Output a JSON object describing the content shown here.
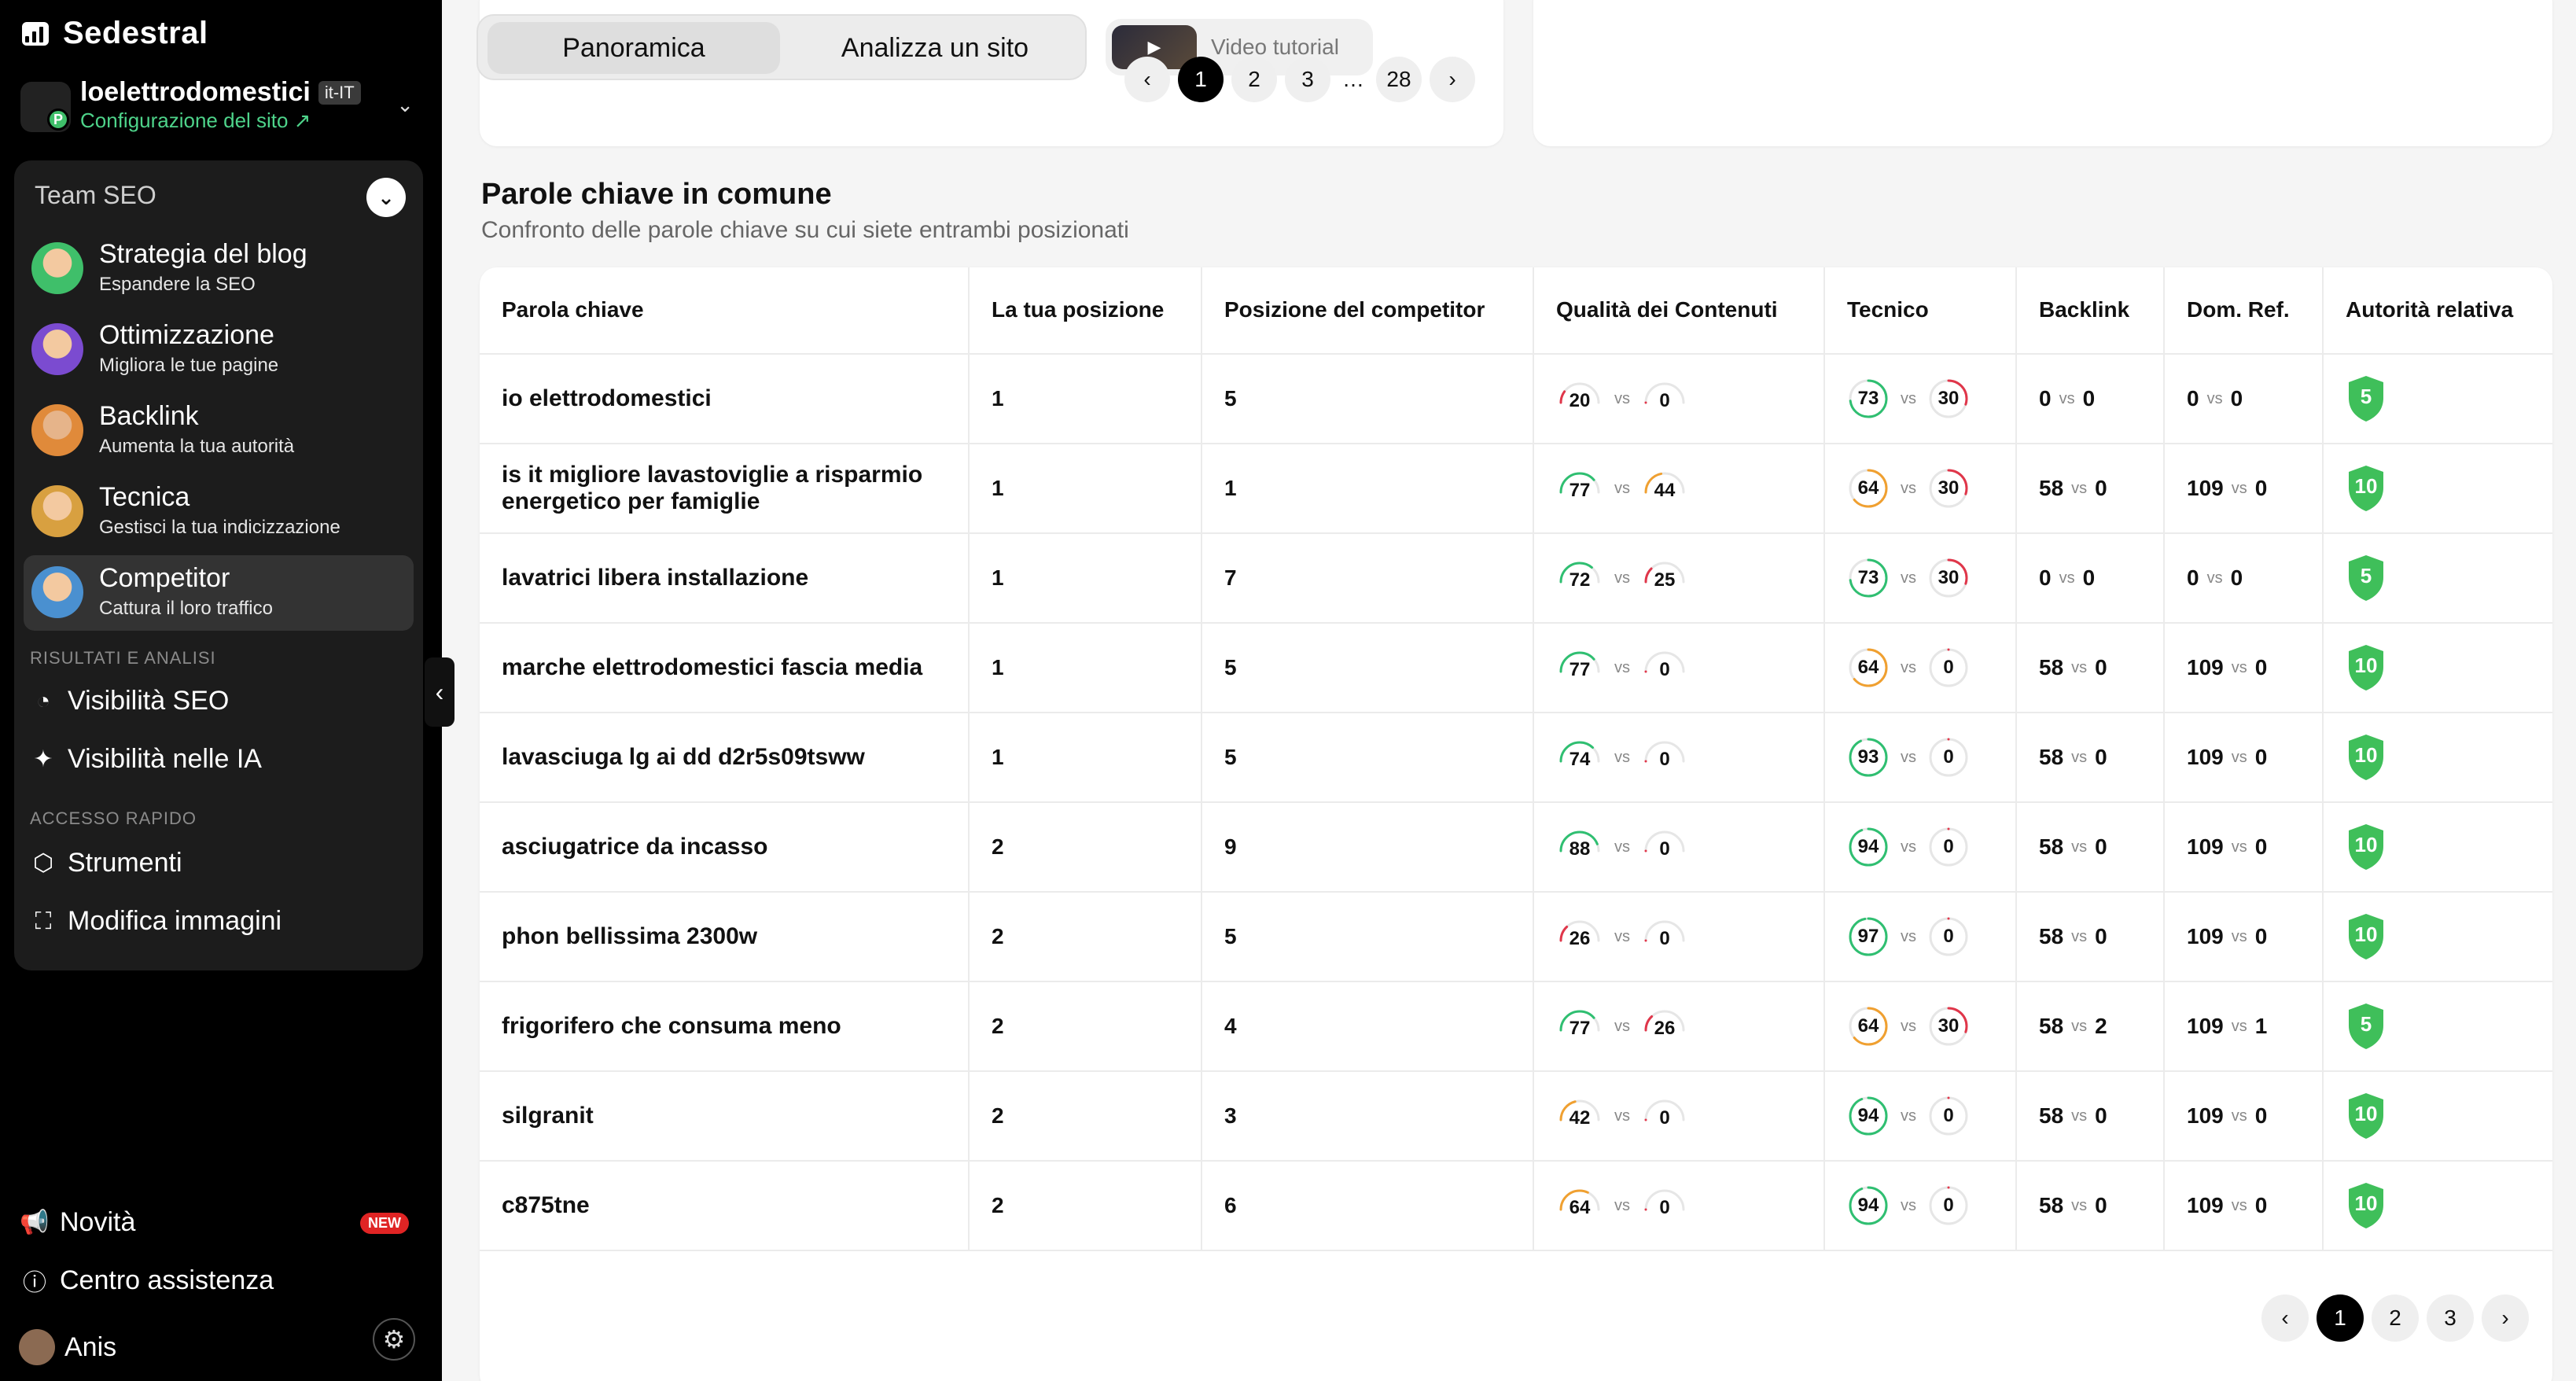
{
  "sidebar": {
    "brand": "Sedestral",
    "site_name": "loelettrodomestici",
    "site_lang": "it-IT",
    "site_config": "Configurazione del sito ↗",
    "team_title": "Team SEO",
    "nav_items": [
      {
        "title": "Strategia del blog",
        "subtitle": "Espandere la SEO"
      },
      {
        "title": "Ottimizzazione",
        "subtitle": "Migliora le tue pagine"
      },
      {
        "title": "Backlink",
        "subtitle": "Aumenta la tua autorità"
      },
      {
        "title": "Tecnica",
        "subtitle": "Gestisci la tua indicizzazione"
      },
      {
        "title": "Competitor",
        "subtitle": "Cattura il loro traffico"
      }
    ],
    "section_results": "RISULTATI E ANALISI",
    "seo_visibility": "Visibilità SEO",
    "ai_visibility": "Visibilità nelle IA",
    "section_quick": "ACCESSO RAPIDO",
    "tools": "Strumenti",
    "edit_images": "Modifica immagini",
    "news": "Novità",
    "news_badge": "NEW",
    "help_center": "Centro assistenza",
    "user_name": "Anis"
  },
  "tabs": {
    "overview": "Panoramica",
    "analyze": "Analizza un sito",
    "video": "Video tutorial"
  },
  "pager_top": {
    "pages": [
      "1",
      "2",
      "3"
    ],
    "dots": "…",
    "last": "28"
  },
  "section": {
    "title": "Parole chiave in comune",
    "subtitle": "Confronto delle parole chiave su cui siete entrambi posizionati"
  },
  "table": {
    "vs_label": "vs",
    "headers": [
      "Parola chiave",
      "La tua posizione",
      "Posizione del competitor",
      "Qualità dei Contenuti",
      "Tecnico",
      "Backlink",
      "Dom. Ref.",
      "Autorità relativa"
    ],
    "rows": [
      {
        "keyword": "io elettrodomestici",
        "my_pos": "1",
        "comp_pos": "5",
        "q_me": "20",
        "q_comp": "0",
        "t_me": "73",
        "t_comp": "30",
        "bl_me": "0",
        "bl_comp": "0",
        "dr_me": "0",
        "dr_comp": "0",
        "authority": "5"
      },
      {
        "keyword": "is it migliore lavastoviglie a risparmio energetico per famiglie",
        "my_pos": "1",
        "comp_pos": "1",
        "q_me": "77",
        "q_comp": "44",
        "t_me": "64",
        "t_comp": "30",
        "bl_me": "58",
        "bl_comp": "0",
        "dr_me": "109",
        "dr_comp": "0",
        "authority": "10"
      },
      {
        "keyword": "lavatrici libera installazione",
        "my_pos": "1",
        "comp_pos": "7",
        "q_me": "72",
        "q_comp": "25",
        "t_me": "73",
        "t_comp": "30",
        "bl_me": "0",
        "bl_comp": "0",
        "dr_me": "0",
        "dr_comp": "0",
        "authority": "5"
      },
      {
        "keyword": "marche elettrodomestici fascia media",
        "my_pos": "1",
        "comp_pos": "5",
        "q_me": "77",
        "q_comp": "0",
        "t_me": "64",
        "t_comp": "0",
        "bl_me": "58",
        "bl_comp": "0",
        "dr_me": "109",
        "dr_comp": "0",
        "authority": "10"
      },
      {
        "keyword": "lavasciuga lg ai dd d2r5s09tsww",
        "my_pos": "1",
        "comp_pos": "5",
        "q_me": "74",
        "q_comp": "0",
        "t_me": "93",
        "t_comp": "0",
        "bl_me": "58",
        "bl_comp": "0",
        "dr_me": "109",
        "dr_comp": "0",
        "authority": "10"
      },
      {
        "keyword": "asciugatrice da incasso",
        "my_pos": "2",
        "comp_pos": "9",
        "q_me": "88",
        "q_comp": "0",
        "t_me": "94",
        "t_comp": "0",
        "bl_me": "58",
        "bl_comp": "0",
        "dr_me": "109",
        "dr_comp": "0",
        "authority": "10"
      },
      {
        "keyword": "phon bellissima 2300w",
        "my_pos": "2",
        "comp_pos": "5",
        "q_me": "26",
        "q_comp": "0",
        "t_me": "97",
        "t_comp": "0",
        "bl_me": "58",
        "bl_comp": "0",
        "dr_me": "109",
        "dr_comp": "0",
        "authority": "10"
      },
      {
        "keyword": "frigorifero che consuma meno",
        "my_pos": "2",
        "comp_pos": "4",
        "q_me": "77",
        "q_comp": "26",
        "t_me": "64",
        "t_comp": "30",
        "bl_me": "58",
        "bl_comp": "2",
        "dr_me": "109",
        "dr_comp": "1",
        "authority": "5"
      },
      {
        "keyword": "silgranit",
        "my_pos": "2",
        "comp_pos": "3",
        "q_me": "42",
        "q_comp": "0",
        "t_me": "94",
        "t_comp": "0",
        "bl_me": "58",
        "bl_comp": "0",
        "dr_me": "109",
        "dr_comp": "0",
        "authority": "10"
      },
      {
        "keyword": "c875tne",
        "my_pos": "2",
        "comp_pos": "6",
        "q_me": "64",
        "q_comp": "0",
        "t_me": "94",
        "t_comp": "0",
        "bl_me": "58",
        "bl_comp": "0",
        "dr_me": "109",
        "dr_comp": "0",
        "authority": "10"
      }
    ]
  },
  "pager_bottom": {
    "pages": [
      "1",
      "2",
      "3"
    ]
  },
  "colors": {
    "score_green": "#2fbf71",
    "score_orange": "#f0a030",
    "score_red": "#e0364a",
    "shield_green": "#3fbf5a",
    "accent_green": "#4ed38a"
  },
  "icons": [
    "logo-bars-icon",
    "chevron-down-icon",
    "chart-pie-icon",
    "sparkle-icon",
    "cube-icon",
    "image-scan-icon",
    "megaphone-icon",
    "help-circle-icon",
    "gear-icon",
    "chevron-left-icon",
    "chevron-right-icon",
    "play-icon"
  ]
}
